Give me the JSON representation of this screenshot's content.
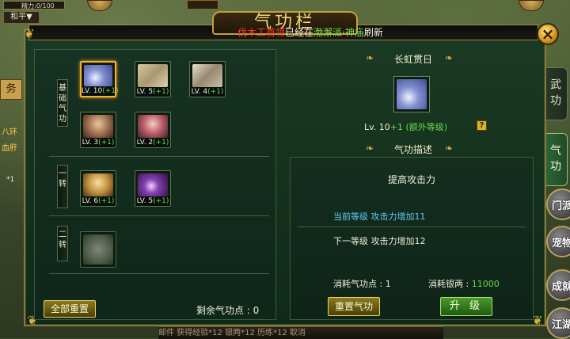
{
  "hud": {
    "energy": "精力:0/100",
    "peace_mode": "和平▼",
    "left_tab": "务",
    "chip_a": "八环",
    "chip_b": "血肝",
    "chip_c": "*1"
  },
  "panel": {
    "title": "气功栏",
    "broadcast": {
      "part1": "伐木工首领",
      "part2": "已经在",
      "part3": "渤澥派",
      "part4": "·",
      "part5": "神庙",
      "part6": "刷新"
    },
    "close_icon": "×"
  },
  "tabs": [
    {
      "label": "武功",
      "active": false
    },
    {
      "label": "气功",
      "active": true
    }
  ],
  "side_icons": [
    "门派",
    "宠物",
    "成就",
    "江湖"
  ],
  "tree": {
    "tiers": [
      {
        "label": "基础气功",
        "skills": [
          {
            "level": "LV. 10",
            "plus": "(+1)",
            "art": "blade",
            "selected": true
          },
          {
            "level": "LV. 5",
            "plus": "(+1)",
            "art": "gold",
            "selected": false
          },
          {
            "level": "LV. 4",
            "plus": "(+1)",
            "art": "scroll",
            "selected": false
          },
          {
            "level": "LV. 3",
            "plus": "(+1)",
            "art": "face1",
            "selected": false
          },
          {
            "level": "LV. 2",
            "plus": "(+1)",
            "art": "face2",
            "selected": false
          }
        ]
      },
      {
        "label": "一转",
        "skills": [
          {
            "level": "LV. 6",
            "plus": "(+1)",
            "art": "face3",
            "selected": false
          },
          {
            "level": "LV. 5",
            "plus": "(+1)",
            "art": "purple",
            "selected": false
          }
        ]
      },
      {
        "label": "二转",
        "skills": [
          {
            "level": "",
            "plus": "",
            "art": "gray",
            "selected": false
          }
        ]
      }
    ],
    "reset_label": "全部重置",
    "remaining": "剩余气功点 : 0"
  },
  "detail": {
    "skill_name": "长虹贯日",
    "level_text": "Lv. 10",
    "level_extra": "+1 (额外等级)",
    "help_icon": "?",
    "desc_title": "气功描述",
    "desc": "提高攻击力",
    "current": "当前等级   攻击力增加11",
    "next": "下一等级   攻击力增加12",
    "cost_points_label": "消耗气功点 : 1",
    "cost_silver_label": "消耗银两 :",
    "cost_silver_value": "11000",
    "reset_btn": "重置气功",
    "upgrade_btn": "升 级"
  },
  "bottom": {
    "text": "邮件    获得经验*12  银两*12  历练*12       取消"
  },
  "colors": {
    "accent_gold": "#f0d060",
    "plus_green": "#6ad84a",
    "current_blue": "#60c8f0",
    "broadcast_red": "#ff3a2a"
  }
}
